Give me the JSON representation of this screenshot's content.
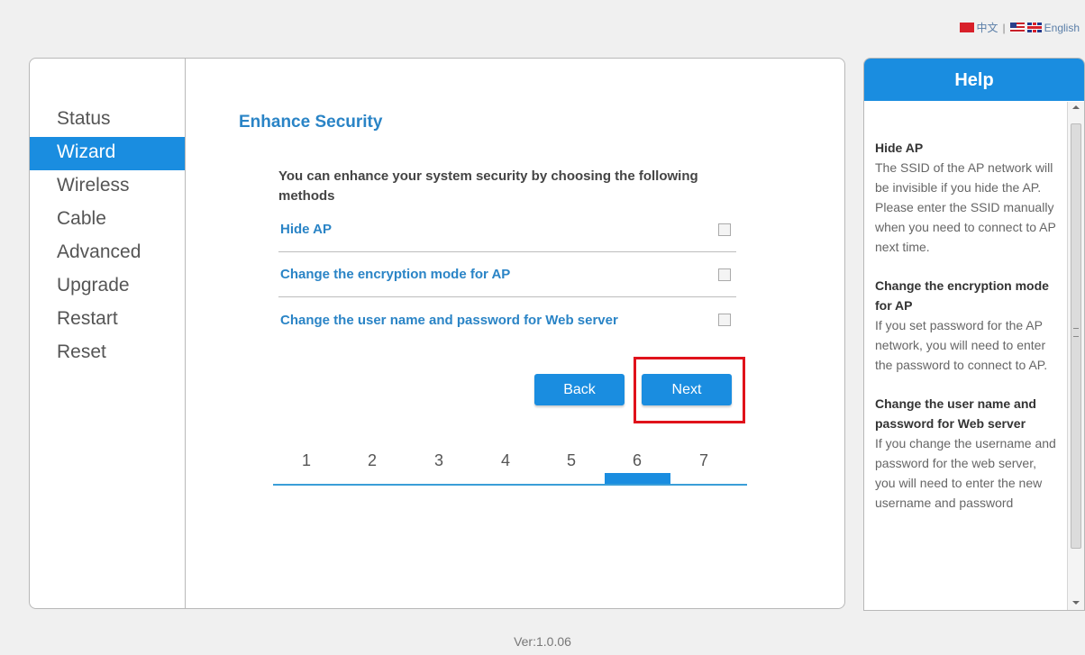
{
  "language": {
    "chinese": "中文",
    "separator": "|",
    "english": "English"
  },
  "sidebar": {
    "items": [
      {
        "label": "Status"
      },
      {
        "label": "Wizard"
      },
      {
        "label": "Wireless"
      },
      {
        "label": "Cable"
      },
      {
        "label": "Advanced"
      },
      {
        "label": "Upgrade"
      },
      {
        "label": "Restart"
      },
      {
        "label": "Reset"
      }
    ],
    "active": "Wizard"
  },
  "main": {
    "title": "Enhance Security",
    "intro": "You can enhance your system security by choosing the following methods",
    "options": [
      {
        "label": "Hide AP",
        "checked": false
      },
      {
        "label": "Change the encryption mode for AP",
        "checked": false
      },
      {
        "label": "Change the user name and password for Web server",
        "checked": false
      }
    ],
    "back_label": "Back",
    "next_label": "Next",
    "steps": [
      "1",
      "2",
      "3",
      "4",
      "5",
      "6",
      "7"
    ],
    "current_step": 6
  },
  "help": {
    "title": "Help",
    "sections": [
      {
        "heading": "Hide AP",
        "text": "The SSID of the AP network will be invisible if you hide the AP. Please enter the SSID manually when you need to connect to AP next time."
      },
      {
        "heading": "Change the encryption mode for AP",
        "text": "If you set password for the AP network, you will need to enter the password to connect to AP."
      },
      {
        "heading": "Change the user name and password for Web server",
        "text": "If you change the username and password for the web server, you will need to enter the new username and password"
      }
    ]
  },
  "version": "Ver:1.0.06",
  "colors": {
    "accent": "#1a8de0",
    "title": "#2a84c6",
    "highlight": "#e0121b"
  }
}
